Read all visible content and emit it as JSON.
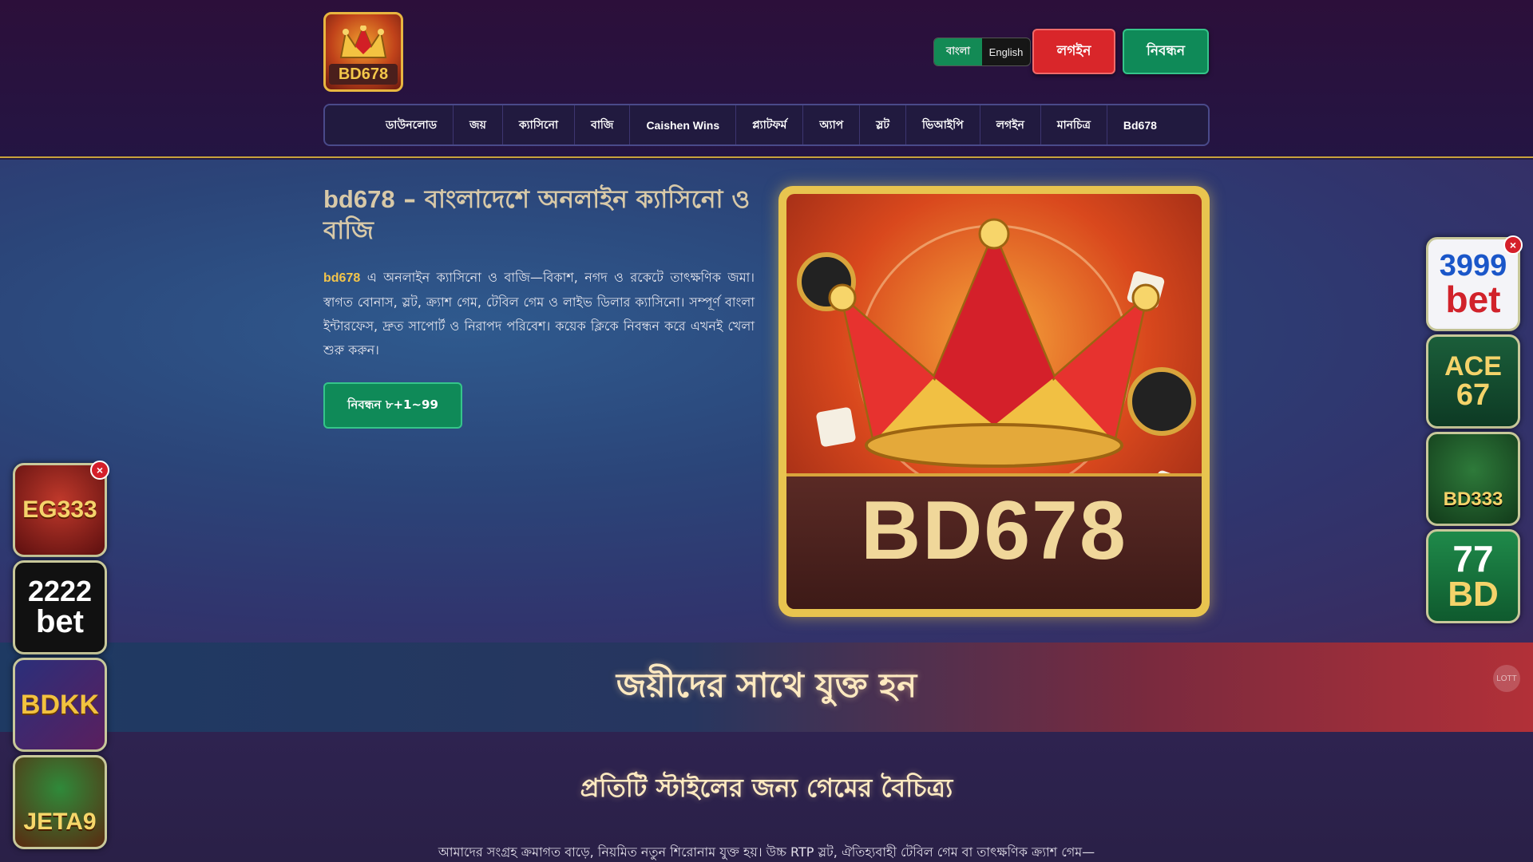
{
  "header": {
    "logo_text": "BD678",
    "lang": {
      "bangla": "বাংলা",
      "english": "English"
    },
    "login_label": "লগইন",
    "register_label": "নিবন্ধন"
  },
  "nav": {
    "items": [
      "ডাউনলোড",
      "জয়",
      "ক্যাসিনো",
      "বাজি",
      "Caishen Wins",
      "প্ল্যাটফর্ম",
      "অ্যাপ",
      "স্লট",
      "ভিআইপি",
      "লগইন",
      "মানচিত্র",
      "Bd678"
    ]
  },
  "hero": {
    "title_brand": "bd678",
    "title_rest": " – বাংলাদেশে অনলাইন ক্যাসিনো ও বাজি",
    "desc_brand": "bd678",
    "desc_rest": " এ অনলাইন ক্যাসিনো ও বাজি—বিকাশ, নগদ ও রকেটে তাৎক্ষণিক জমা। স্বাগত বোনাস, স্লট, ক্র্যাশ গেম, টেবিল গেম ও লাইভ ডিলার ক্যাসিনো। সম্পূর্ণ বাংলা ইন্টারফেস, দ্রুত সাপোর্ট ও নিরাপদ পরিবেশ। কয়েক ক্লিকে নিবন্ধন করে এখনই খেলা শুরু করুন।",
    "cta_label": "নিবন্ধন ৮+1~99",
    "image_text": "BD678"
  },
  "join": {
    "title": "জয়ীদের সাথে যুক্ত হন",
    "icon_label": "LOTT"
  },
  "games_section": {
    "title": "প্রতিটি স্টাইলের জন্য গেমের বৈচিত্র্য",
    "desc": "আমাদের সংগ্রহ ক্রমাগত বাড়ে, নিয়মিত নতুন শিরোনাম যুক্ত হয়। উচ্চ RTP স্লট, ঐতিহ্যবাহী টেবিল গেম বা তাৎক্ষণিক ক্র্যাশ গেম—"
  },
  "ads_left": {
    "close": "×",
    "items": [
      {
        "line1": "EG333",
        "line2": ""
      },
      {
        "line1": "2222",
        "line2": "bet"
      },
      {
        "line1": "BDKK",
        "line2": ""
      },
      {
        "line1": "JETA9",
        "line2": ""
      }
    ]
  },
  "ads_right": {
    "close": "×",
    "items": [
      {
        "line1": "3999",
        "line2": "bet"
      },
      {
        "line1": "ACE",
        "line2": "67"
      },
      {
        "line1": "BD333",
        "line2": ""
      },
      {
        "line1": "77",
        "line2": "BD"
      }
    ]
  },
  "colors": {
    "accent_green": "#0f8a58",
    "accent_red": "#d9262a",
    "gold": "#f4c54a"
  }
}
